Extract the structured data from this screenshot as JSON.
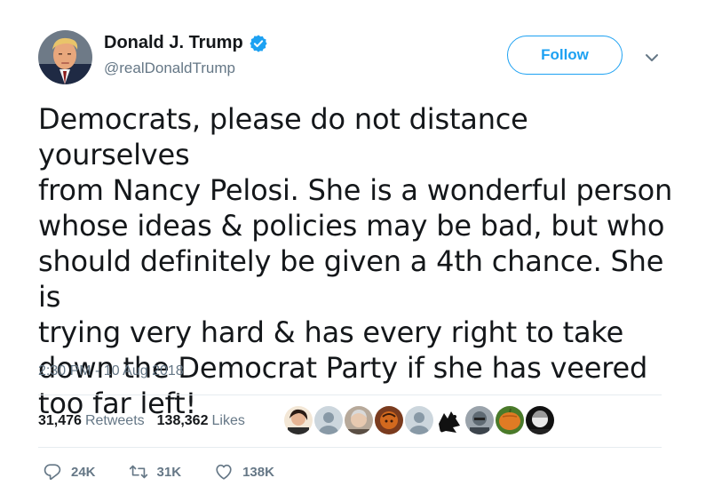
{
  "author": {
    "display_name": "Donald J. Trump",
    "handle": "@realDonaldTrump",
    "verified": true
  },
  "follow_label": "Follow",
  "tweet": {
    "lines": [
      "Democrats, please do not distance yourselves",
      "from Nancy Pelosi. She is a wonderful person",
      "whose ideas & policies may be bad, but who",
      "should definitely be given a 4th chance. She is",
      "trying very hard & has every right to take",
      "down the Democrat Party if she has veered",
      "too far left!"
    ],
    "timestamp": "2:30 PM - 10 Aug 2018"
  },
  "stats": {
    "retweets_count": "31,476",
    "retweets_label": "Retweets",
    "likes_count": "138,362",
    "likes_label": "Likes"
  },
  "actions": {
    "reply_count": "24K",
    "retweet_count": "31K",
    "like_count": "138K"
  },
  "icons": {
    "verified": "verified-badge-icon",
    "caret": "chevron-down-icon",
    "reply": "reply-icon",
    "retweet": "retweet-icon",
    "like": "heart-icon"
  },
  "colors": {
    "accent": "#1da1f2",
    "text": "#14171a",
    "muted": "#657786",
    "divider": "#e6ecf0"
  }
}
